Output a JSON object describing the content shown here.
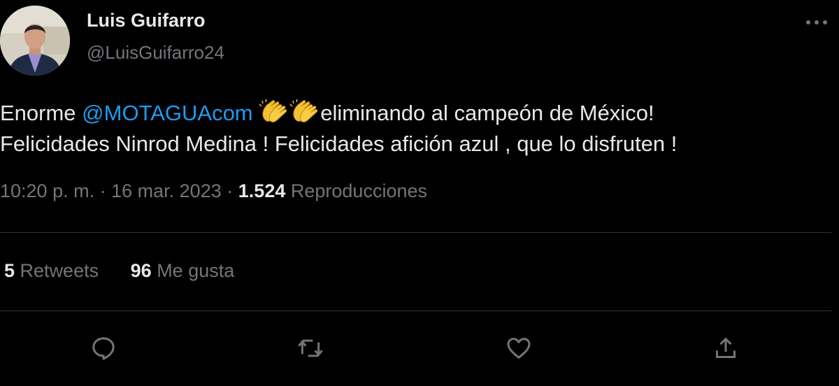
{
  "author": {
    "name": "Luis Guifarro",
    "handle": "@LuisGuifarro24",
    "avatar_icon": "person-photo"
  },
  "tweet": {
    "text_start": "Enorme ",
    "mention": "@MOTAGUAcom",
    "emoji": "clapping-hands",
    "text_line1_end": "eliminando al campeón de México!",
    "text_line2": "Felicidades Ninrod Medina ! Felicidades afición azul , que lo disfruten !"
  },
  "meta": {
    "time": "10:20 p. m.",
    "separator": "·",
    "date": "16 mar. 2023",
    "views_count": "1.524",
    "views_label": "Reproducciones"
  },
  "stats": {
    "retweets_count": "5",
    "retweets_label": "Retweets",
    "likes_count": "96",
    "likes_label": "Me gusta"
  },
  "actions": [
    {
      "name": "reply",
      "icon": "speech-bubble-icon"
    },
    {
      "name": "retweet",
      "icon": "retweet-arrows-icon"
    },
    {
      "name": "like",
      "icon": "heart-icon"
    },
    {
      "name": "share",
      "icon": "share-upload-icon"
    }
  ],
  "colors": {
    "background": "#000000",
    "text": "#e7e9ea",
    "secondary": "#71767b",
    "accent": "#1d9bf0",
    "divider": "#2f3336"
  }
}
